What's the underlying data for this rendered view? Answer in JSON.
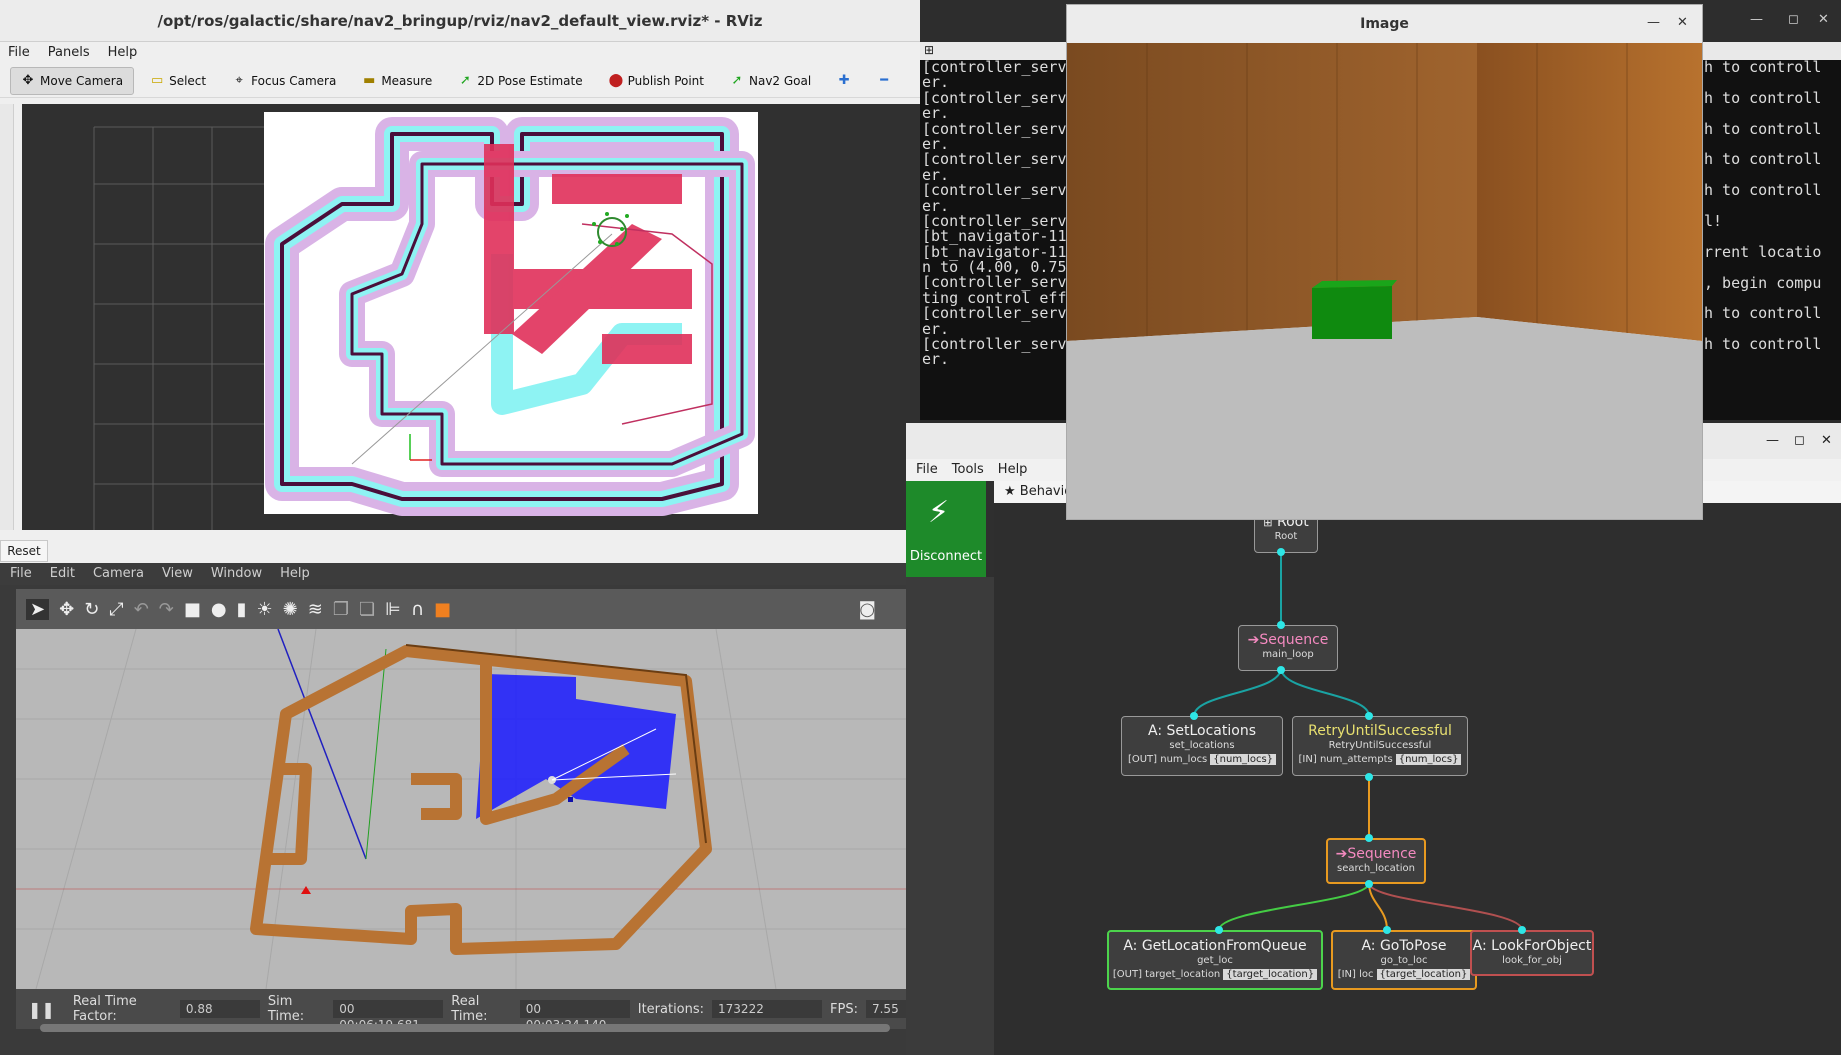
{
  "rviz": {
    "title": "/opt/ros/galactic/share/nav2_bringup/rviz/nav2_default_view.rviz* - RViz",
    "menu": [
      "File",
      "Panels",
      "Help"
    ],
    "tools": [
      {
        "label": "Move Camera",
        "icon": "move-camera-icon"
      },
      {
        "label": "Select",
        "icon": "select-icon"
      },
      {
        "label": "Focus Camera",
        "icon": "focus-camera-icon"
      },
      {
        "label": "Measure",
        "icon": "measure-icon"
      },
      {
        "label": "2D Pose Estimate",
        "icon": "pose-estimate-icon"
      },
      {
        "label": "Publish Point",
        "icon": "publish-point-icon"
      },
      {
        "label": "Nav2 Goal",
        "icon": "nav2-goal-icon"
      }
    ],
    "reset_label": "Reset"
  },
  "terminal": {
    "lines": [
      "[controller_serve",
      "er.",
      "[controller_serve",
      "er.",
      "[controller_serve",
      "er.",
      "[controller_serve",
      "er.",
      "[controller_serve",
      "er.",
      "[controller_serve",
      "[bt_navigator-11]",
      "[bt_navigator-11]",
      "n to (4.00, 0.75)",
      "[controller_serve",
      "ting control effo",
      "[controller_serve",
      "er.",
      "[controller_serve",
      "er."
    ],
    "right_lines": [
      "h to controll",
      "h to controll",
      "h to controll",
      "h to controll",
      "h to controll",
      "l!",
      "rrent locatio",
      ", begin compu",
      "h to controll",
      "h to controll"
    ]
  },
  "image_window": {
    "title": "Image"
  },
  "gazebo": {
    "menu": [
      "File",
      "Edit",
      "Camera",
      "View",
      "Window",
      "Help"
    ],
    "status": {
      "rtf_label": "Real Time Factor:",
      "rtf_value": "0.88",
      "sim_label": "Sim Time:",
      "sim_value": "00 00:06:19.681",
      "real_label": "Real Time:",
      "real_value": "00 00:03:24.140",
      "iter_label": "Iterations:",
      "iter_value": "173222",
      "fps_label": "FPS:",
      "fps_value": "7.55"
    }
  },
  "groot": {
    "menu": [
      "File",
      "Tools",
      "Help"
    ],
    "disconnect_label": "Disconnect",
    "tab_label": "Behavio",
    "nodes": {
      "root": {
        "title": "Root",
        "sub": "Root"
      },
      "seq_main": {
        "title": "Sequence",
        "sub": "main_loop"
      },
      "set_locations": {
        "title": "A: SetLocations",
        "sub": "set_locations",
        "port_label": "[OUT] num_locs",
        "port_value": "{num_locs}"
      },
      "retry": {
        "title": "RetryUntilSuccessful",
        "sub": "RetryUntilSuccessful",
        "port_label": "[IN] num_attempts",
        "port_value": "{num_locs}"
      },
      "seq_search": {
        "title": "Sequence",
        "sub": "search_location"
      },
      "get_loc": {
        "title": "A: GetLocationFromQueue",
        "sub": "get_loc",
        "port_label": "[OUT] target_location",
        "port_value": "{target_location}"
      },
      "go_to_pose": {
        "title": "A: GoToPose",
        "sub": "go_to_loc",
        "port_label": "[IN] loc",
        "port_value": "{target_location}"
      },
      "look_for_obj": {
        "title": "A: LookForObject",
        "sub": "look_for_obj"
      }
    }
  },
  "colors": {
    "success": "#4cd44c",
    "running": "#f0a030",
    "failure": "#c05050",
    "idle_port": "#2ee6e6"
  }
}
